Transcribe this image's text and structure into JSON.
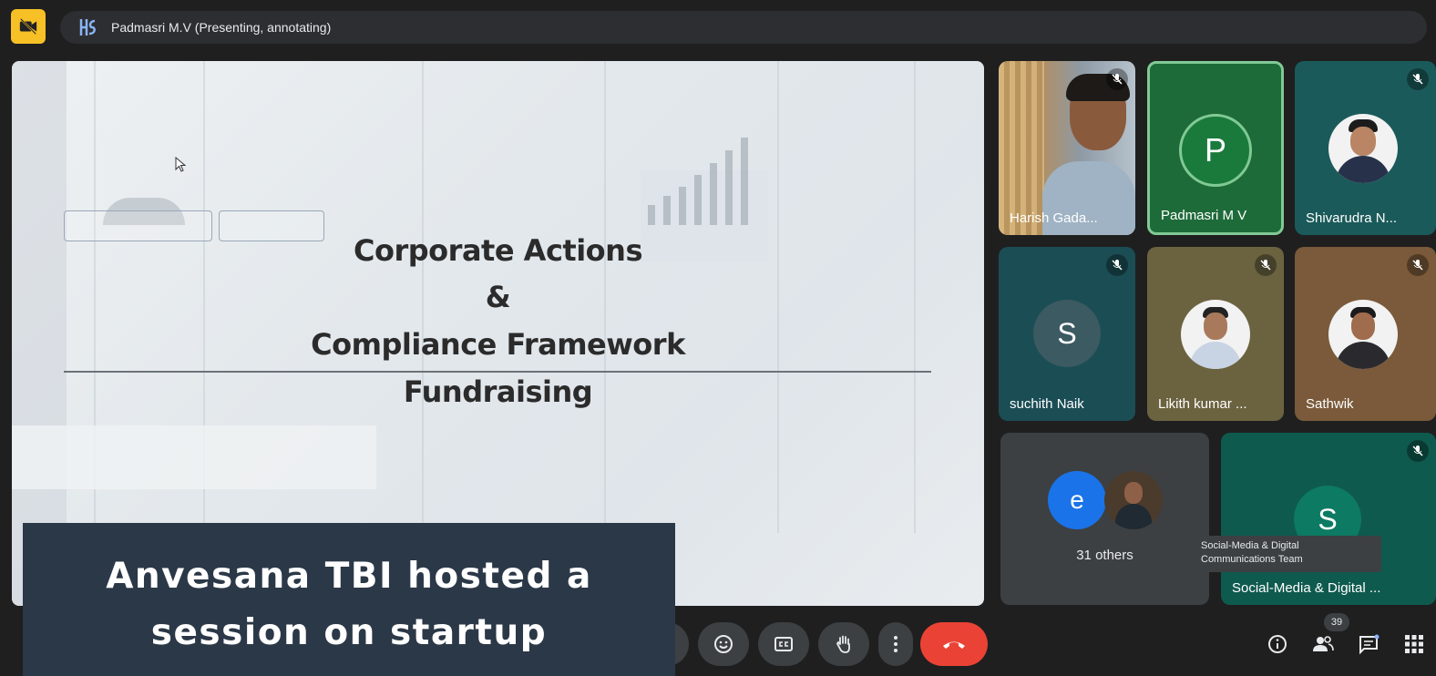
{
  "topbar": {
    "presenter_label": "Padmasri M.V (Presenting, annotating)"
  },
  "slide": {
    "line1": "Corporate Actions",
    "line2": "&",
    "line3": "Compliance Framework",
    "line4": "Fundraising"
  },
  "tiles": [
    {
      "name": "Harish Gada...",
      "type": "video",
      "muted": true
    },
    {
      "name": "Padmasri M V",
      "type": "avatar",
      "initial": "P",
      "speaking": true
    },
    {
      "name": "Shivarudra N...",
      "type": "photo",
      "muted": true
    },
    {
      "name": "suchith Naik",
      "type": "avatar",
      "initial": "S",
      "muted": true
    },
    {
      "name": "Likith kumar ...",
      "type": "photo",
      "muted": true
    },
    {
      "name": "Sathwik",
      "type": "photo",
      "muted": true
    }
  ],
  "others": {
    "initial": "e",
    "label": "31 others"
  },
  "team_tile": {
    "initial": "S",
    "name": "Social-Media & Digital ...",
    "muted": true
  },
  "tooltip": {
    "line1": "Social-Media & Digital",
    "line2": "Communications Team"
  },
  "overlay": {
    "line1": "Anvesana TBI hosted a",
    "line2": "session on startup"
  },
  "controls": {
    "people_count": "39"
  },
  "colors": {
    "accent_yellow": "#f6c026",
    "hangup": "#ea4335",
    "speaking_border": "#81c995",
    "overlay_bg": "#2b3847"
  }
}
